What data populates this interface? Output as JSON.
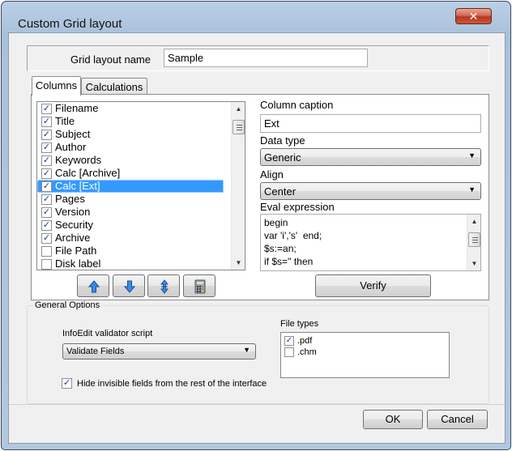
{
  "window": {
    "title": "Custom Grid layout",
    "close_glyph": "✕"
  },
  "layout_name": {
    "label": "Grid layout name",
    "value": "Sample"
  },
  "tabs": [
    {
      "label": "Columns",
      "active": true
    },
    {
      "label": "Calculations",
      "active": false
    }
  ],
  "columns_list": {
    "items": [
      {
        "label": "Filename",
        "checked": true
      },
      {
        "label": "Title",
        "checked": true
      },
      {
        "label": "Subject",
        "checked": true
      },
      {
        "label": "Author",
        "checked": true
      },
      {
        "label": "Keywords",
        "checked": true
      },
      {
        "label": "Calc  [Archive]",
        "checked": true
      },
      {
        "label": "Calc  [Ext]",
        "checked": true,
        "selected": true
      },
      {
        "label": "Pages",
        "checked": true
      },
      {
        "label": "Version",
        "checked": true
      },
      {
        "label": "Security",
        "checked": true
      },
      {
        "label": "Archive",
        "checked": true
      },
      {
        "label": "File Path",
        "checked": false
      },
      {
        "label": "Disk label",
        "checked": false
      }
    ]
  },
  "toolbar": {
    "buttons": [
      {
        "name": "move-up-button",
        "icon": "arrow-up-icon"
      },
      {
        "name": "move-down-button",
        "icon": "arrow-down-icon"
      },
      {
        "name": "move-updown-button",
        "icon": "arrows-updown-icon"
      },
      {
        "name": "calculator-button",
        "icon": "calculator-icon"
      }
    ]
  },
  "column_caption": {
    "label": "Column caption",
    "value": "Ext"
  },
  "data_type": {
    "label": "Data type",
    "value": "Generic"
  },
  "align": {
    "label": "Align",
    "value": "Center"
  },
  "eval_expression": {
    "label": "Eval expression",
    "lines": [
      "begin",
      "var 'i','s'  end;",
      "$s:=an;",
      "if $s='' then"
    ]
  },
  "verify_button": {
    "label": "Verify"
  },
  "general_options": {
    "title": "General Options",
    "validator_label": "InfoEdit validator script",
    "validator_value": "Validate Fields",
    "file_types_label": "File types",
    "file_types": [
      {
        "label": ".pdf",
        "checked": true
      },
      {
        "label": ".chm",
        "checked": false
      }
    ],
    "hide_fields_label": "Hide invisible fields from the rest of the interface",
    "hide_fields_checked": true
  },
  "footer": {
    "ok_label": "OK",
    "cancel_label": "Cancel"
  },
  "colors": {
    "selection": "#3399ff",
    "title_bar": "#b9d0e6",
    "close_button": "#c9593f"
  }
}
